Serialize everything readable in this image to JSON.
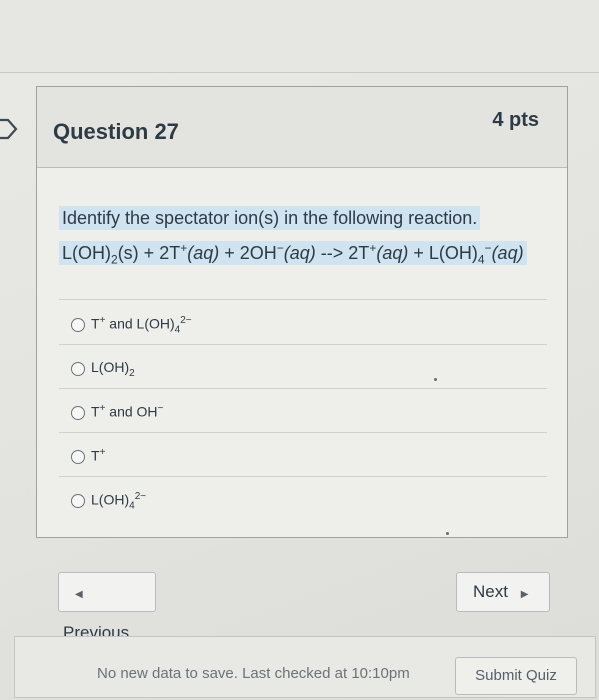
{
  "question": {
    "title": "Question 27",
    "points": "4 pts",
    "prompt_line1": "Identify the spectator ion(s) in the following reaction.",
    "reaction": {
      "p1": "L(OH)",
      "p1_sub": "2",
      "p2": "(s) + 2T",
      "p2_sup": "+",
      "p3": "(aq)",
      "p4": " + 2OH",
      "p4_sup": "−",
      "p5": "(aq)",
      "p6": " --> 2T",
      "p6_sup": "+",
      "p7": "(aq)",
      "p8": " + L(OH)",
      "p8_sub": "4",
      "p8_sup": "−",
      "p9": "(aq)"
    }
  },
  "answers": [
    {
      "a": "T",
      "a_sup": "+",
      "b": " and L(OH)",
      "b_sub": "4",
      "b_sup": "2−"
    },
    {
      "a": "L(OH)",
      "a_sub": "2"
    },
    {
      "a": "T",
      "a_sup": "+",
      "b": " and OH",
      "b_sup": "−"
    },
    {
      "a": "T",
      "a_sup": "+"
    },
    {
      "a": "L(OH)",
      "a_sub": "4",
      "a_sup": "2−"
    }
  ],
  "nav": {
    "previous_label": "Previous",
    "next_label": "Next"
  },
  "footer": {
    "status": "No new data to save. Last checked at 10:10pm",
    "submit_label": "Submit Quiz"
  },
  "icons": {
    "previous": "chevron-left-icon",
    "next": "chevron-right-icon",
    "question_marker": "arrow-marker-icon"
  },
  "colors": {
    "text": "#2d3b45",
    "highlight": "#cfe3f0",
    "border": "#9ea2a4"
  }
}
